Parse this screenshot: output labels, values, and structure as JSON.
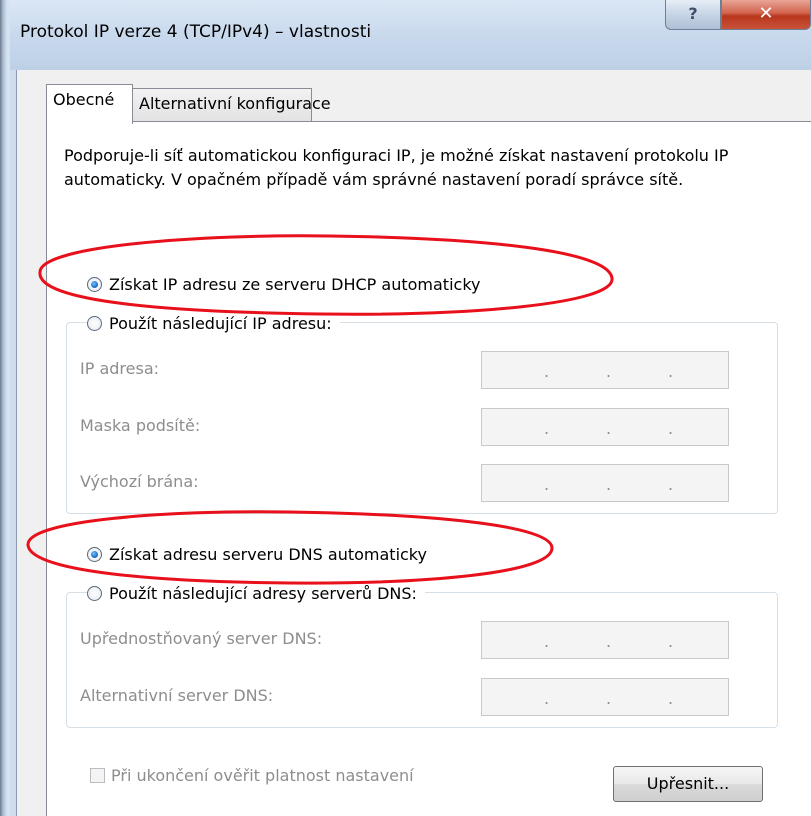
{
  "window": {
    "title": "Protokol IP verze 4 (TCP/IPv4) – vlastnosti",
    "help_label": "?",
    "close_label": "✕",
    "help_icon": "question-mark-icon",
    "close_icon": "close-icon"
  },
  "tabs": [
    {
      "label": "Obecné",
      "selected": true
    },
    {
      "label": "Alternativní konfigurace",
      "selected": false
    }
  ],
  "intro_text": "Podporuje-li síť automatickou konfiguraci IP, je možné získat nastavení protokolu IP automaticky. V opačném případě vám správné nastavení poradí správce sítě.",
  "ip_section": {
    "auto_option": "Získat IP adresu ze serveru DHCP automaticky",
    "auto_selected": true,
    "manual_option": "Použít následující IP adresu:",
    "fields": [
      {
        "label": "IP adresa:",
        "value": ". . ."
      },
      {
        "label": "Maska podsítě:",
        "value": ". . ."
      },
      {
        "label": "Výchozí brána:",
        "value": ". . ."
      }
    ]
  },
  "dns_section": {
    "auto_option": "Získat adresu serveru DNS automaticky",
    "auto_selected": true,
    "manual_option": "Použít následující adresy serverů DNS:",
    "fields": [
      {
        "label": "Upřednostňovaný server DNS:",
        "value": ". . ."
      },
      {
        "label": "Alternativní server DNS:",
        "value": ". . ."
      }
    ]
  },
  "validate_checkbox": {
    "label": "Při ukončení ověřit platnost nastavení",
    "checked": false,
    "enabled": false
  },
  "advanced_button": "Upřesnit...",
  "colors": {
    "annotation_ellipse": "#e8101a",
    "radio_dot": "#1565b8",
    "disabled_text": "#8d8d8d"
  }
}
